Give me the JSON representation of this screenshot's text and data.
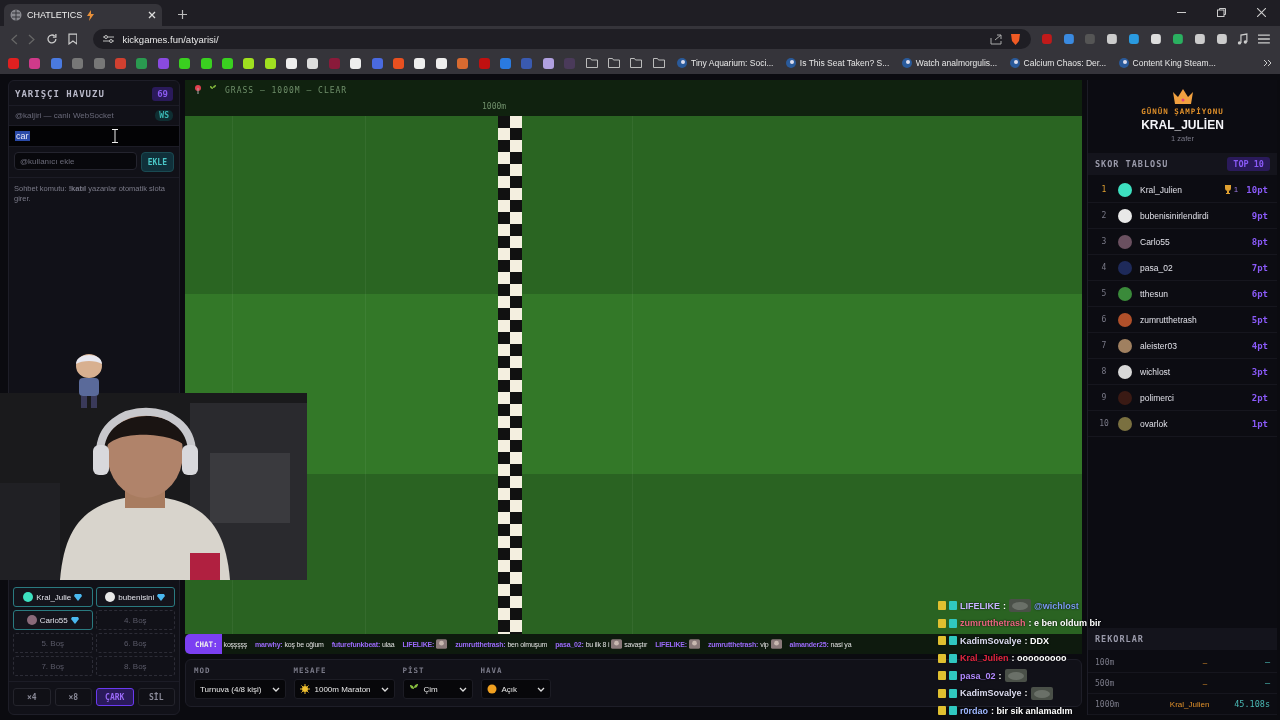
{
  "browser": {
    "tab": {
      "title": "CHATLETICS"
    },
    "url": "kickgames.fun/atyarisi/",
    "bookmarks": [
      {
        "label": "Tiny Aquarium: Soci..."
      },
      {
        "label": "Is This Seat Taken? S..."
      },
      {
        "label": "Watch analmorgulis..."
      },
      {
        "label": "Calcium Chaos: Der..."
      },
      {
        "label": "Content King Steam..."
      }
    ]
  },
  "pool": {
    "title": "YARIŞÇI HAVUZU",
    "count": "69",
    "source": "@kaljiri — canlı WebSocket",
    "source_badge": "WS",
    "search_value": "car",
    "add_placeholder": "@kullanıcı ekle",
    "add_button": "EKLE",
    "hint": "Sohbet komutu: **!katıl** yazanlar otomatik slota girer."
  },
  "slots": [
    {
      "label": "Kral_Julie",
      "filled": true,
      "color": "#3de0c0"
    },
    {
      "label": "bubenisini",
      "filled": true,
      "color": "#e8e8e8"
    },
    {
      "label": "Carlo55",
      "filled": true,
      "color": "#8a6a7a"
    },
    {
      "label": "4. Boş",
      "filled": false
    },
    {
      "label": "5. Boş",
      "filled": false
    },
    {
      "label": "6. Boş",
      "filled": false
    },
    {
      "label": "7. Boş",
      "filled": false
    },
    {
      "label": "8. Boş",
      "filled": false
    }
  ],
  "slot_buttons": [
    {
      "label": "×4",
      "selected": false
    },
    {
      "label": "×8",
      "selected": false
    },
    {
      "label": "ÇARK",
      "selected": true
    },
    {
      "label": "SİL",
      "selected": false
    }
  ],
  "track": {
    "info": "GRASS — 1000M — CLEAR",
    "finish_label": "1000m"
  },
  "ticker": {
    "label": "CHAT:",
    "lead": "koşşşşş",
    "messages": [
      {
        "user": "marwhy:",
        "parts": [
          {
            "kind": "text",
            "text": "koş be oğlum"
          }
        ]
      },
      {
        "user": "futurefunkbeat:",
        "parts": [
          {
            "kind": "text",
            "text": "ulaa"
          }
        ]
      },
      {
        "user": "LIFELIKE:",
        "parts": [
          {
            "kind": "emote"
          }
        ]
      },
      {
        "user": "zumrutthetrash:",
        "parts": [
          {
            "kind": "text",
            "text": "ben olmuşum"
          }
        ]
      },
      {
        "user": "pasa_02:",
        "parts": [
          {
            "kind": "text",
            "text": "bu ilk 8 i"
          },
          {
            "kind": "emote"
          },
          {
            "kind": "text",
            "text": "savaştır"
          }
        ]
      },
      {
        "user": "LIFELIKE:",
        "parts": [
          {
            "kind": "emote"
          }
        ]
      },
      {
        "user": "zumrutthetrash:",
        "parts": [
          {
            "kind": "text",
            "text": "vip"
          },
          {
            "kind": "emote"
          }
        ]
      },
      {
        "user": "almander25:",
        "parts": [
          {
            "kind": "text",
            "text": "nasi ya"
          }
        ]
      }
    ]
  },
  "settings": [
    {
      "label": "MOD",
      "value": "Turnuva (4/8 kişi)"
    },
    {
      "label": "MESAFE",
      "value": "1000m Maraton"
    },
    {
      "label": "PİST",
      "value": "Çim"
    },
    {
      "label": "HAVA",
      "value": "Açık"
    }
  ],
  "chat_overlay": [
    {
      "user": "LIFELIKE",
      "color": "#c7b6ff",
      "parts": [
        {
          "kind": "text",
          "text": ":"
        },
        {
          "kind": "emote"
        },
        {
          "kind": "mention",
          "text": "@wichlost"
        }
      ]
    },
    {
      "user": "zumrutthetrash",
      "color": "#e8667f",
      "parts": [
        {
          "kind": "text",
          "text": ": e ben oldum bir"
        }
      ]
    },
    {
      "user": "KadimSovalye",
      "color": "#dcdcf0",
      "parts": [
        {
          "kind": "text",
          "text": ": DDX"
        }
      ]
    },
    {
      "user": "Kral_Julien",
      "color": "#e3263f",
      "parts": [
        {
          "kind": "text",
          "text": ": ooooooooo"
        }
      ]
    },
    {
      "user": "pasa_02",
      "color": "#b28aff",
      "parts": [
        {
          "kind": "text",
          "text": ":"
        },
        {
          "kind": "emote"
        }
      ]
    },
    {
      "user": "KadimSovalye",
      "color": "#dcdcf0",
      "parts": [
        {
          "kind": "text",
          "text": ":"
        },
        {
          "kind": "emote"
        }
      ]
    },
    {
      "user": "r0rdao",
      "color": "#9fb8ff",
      "parts": [
        {
          "kind": "text",
          "text": ": bir sik anlamadım"
        }
      ]
    }
  ],
  "champion": {
    "title": "GÜNÜN ŞAMPİYONU",
    "name": "KRAL_JULİEN",
    "wins": "1 zafer"
  },
  "scoreboard": {
    "title": "SKOR TABLOSU",
    "badge": "TOP 10",
    "rows": [
      {
        "rank": "1",
        "name": "Kral_Julien",
        "points": "10pt",
        "wins": "1",
        "color": "#3de0c0"
      },
      {
        "rank": "2",
        "name": "bubenisinirlendirdi",
        "points": "9pt",
        "color": "#e8e8e8"
      },
      {
        "rank": "3",
        "name": "Carlo55",
        "points": "8pt",
        "color": "#6a5060"
      },
      {
        "rank": "4",
        "name": "pasa_02",
        "points": "7pt",
        "color": "#1e2a5a"
      },
      {
        "rank": "5",
        "name": "tthesun",
        "points": "6pt",
        "color": "#3a8a3a"
      },
      {
        "rank": "6",
        "name": "zumrutthetrash",
        "points": "5pt",
        "color": "#b0502a"
      },
      {
        "rank": "7",
        "name": "aleister03",
        "points": "4pt",
        "color": "#a08060"
      },
      {
        "rank": "8",
        "name": "wichlost",
        "points": "3pt",
        "color": "#d8d8d8"
      },
      {
        "rank": "9",
        "name": "polimerci",
        "points": "2pt",
        "color": "#3a1a14"
      },
      {
        "rank": "10",
        "name": "ovarlok",
        "points": "1pt",
        "color": "#7a7040"
      }
    ]
  },
  "records": {
    "title": "REKORLAR",
    "rows": [
      {
        "distance": "100m",
        "holder": "–",
        "time": "–"
      },
      {
        "distance": "500m",
        "holder": "–",
        "time": "–"
      },
      {
        "distance": "1000m",
        "holder": "Kral_Julien",
        "time": "45.108s"
      }
    ]
  }
}
